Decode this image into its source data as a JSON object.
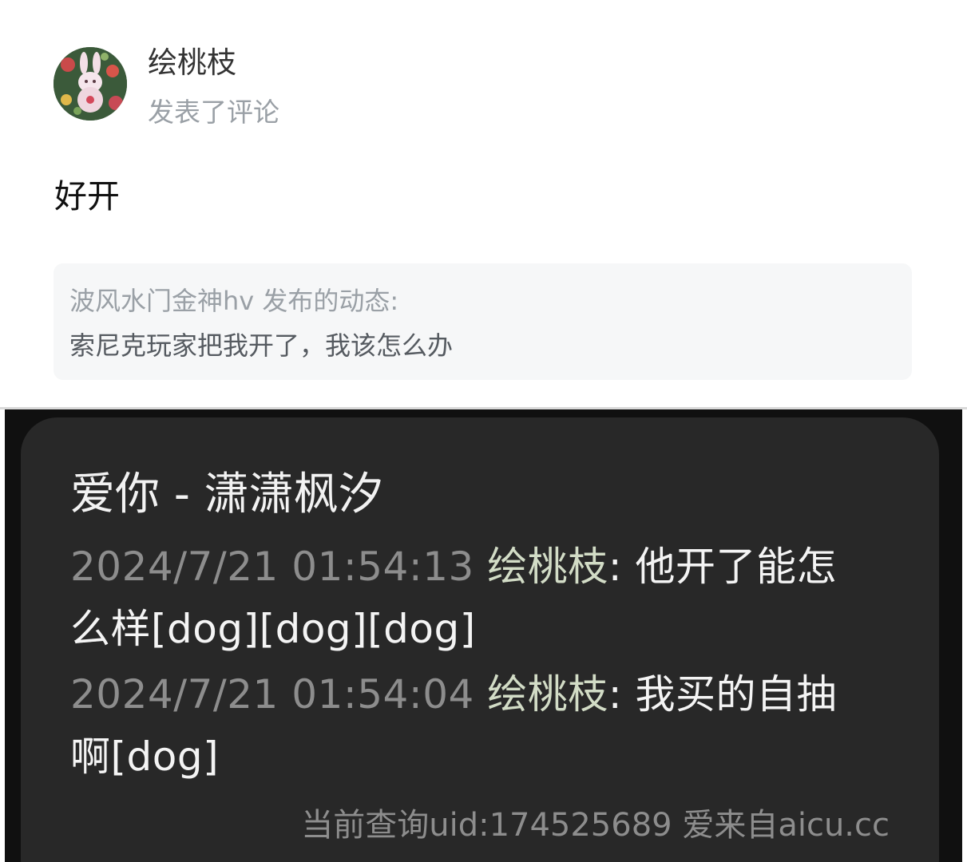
{
  "comment": {
    "avatar_icon": "bunny-avatar-icon",
    "username": "绘桃枝",
    "action": "发表了评论",
    "text": "好开",
    "quote": {
      "source": "波风水门金神hv 发布的动态:",
      "text": "索尼克玩家把我开了，我该怎么办"
    }
  },
  "dialog": {
    "title": "爱你 - 潇潇枫汐",
    "records": [
      {
        "timestamp": "2024/7/21 01:54:13",
        "nickname": "绘桃枝",
        "separator": ": ",
        "message": "他开了能怎么样[dog][dog][dog]"
      },
      {
        "timestamp": "2024/7/21 01:54:04",
        "nickname": "绘桃枝",
        "separator": ": ",
        "message": "我买的自抽啊[dog]"
      }
    ],
    "footer": "当前查询uid:174525689 爱来自aicu.cc"
  },
  "colors": {
    "background": "#ffffff",
    "quote_background": "#f6f7f8",
    "dialog_background": "#282828",
    "timestamp": "#8d8d8d",
    "nickname": "#d2dcc6",
    "message": "#f4f4f4"
  }
}
